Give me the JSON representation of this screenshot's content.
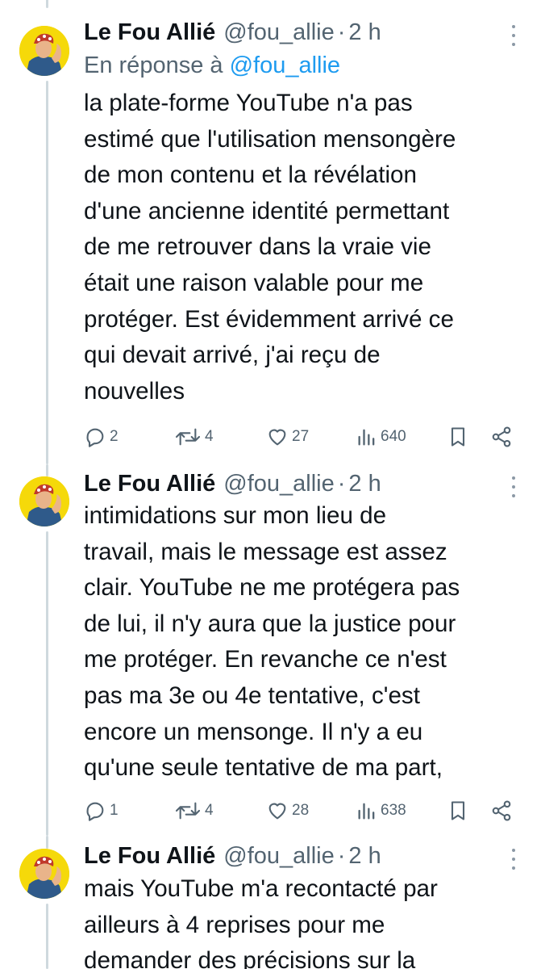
{
  "colors": {
    "text": "#0f1419",
    "secondary": "#536471",
    "accent": "#1d9bf0",
    "avatar_bg": "#f5d90a"
  },
  "tweets": [
    {
      "author_name": "Le Fou Allié",
      "handle": "@fou_allie",
      "separator": "·",
      "time": "2 h",
      "reply_prefix": "En réponse à",
      "reply_mention": "@fou_allie",
      "lines": [
        "la plate-forme YouTube n'a pas",
        "estimé que l'utilisation mensongère",
        "de mon contenu et la révélation",
        "d'une ancienne identité permettant",
        "de me retrouver dans la vraie vie",
        "était une raison valable pour me",
        "protéger. Est évidemment arrivé ce",
        "qui devait arrivé, j'ai reçu de",
        "nouvelles"
      ],
      "replies": "2",
      "retweets": "4",
      "likes": "27",
      "views": "640"
    },
    {
      "author_name": "Le Fou Allié",
      "handle": "@fou_allie",
      "separator": "·",
      "time": "2 h",
      "lines": [
        "intimidations sur mon lieu de",
        "travail, mais le message est assez",
        "clair. YouTube ne me protégera pas",
        "de lui, il n'y aura que la justice pour",
        "me protéger. En revanche ce n'est",
        "pas ma 3e ou 4e tentative, c'est",
        "encore un mensonge. Il n'y a eu",
        "qu'une seule tentative de ma part,"
      ],
      "replies": "1",
      "retweets": "4",
      "likes": "28",
      "views": "638"
    },
    {
      "author_name": "Le Fou Allié",
      "handle": "@fou_allie",
      "separator": "·",
      "time": "2 h",
      "lines": [
        "mais YouTube m'a recontacté par",
        "ailleurs à 4 reprises pour me",
        "demander des précisions sur la"
      ]
    }
  ]
}
